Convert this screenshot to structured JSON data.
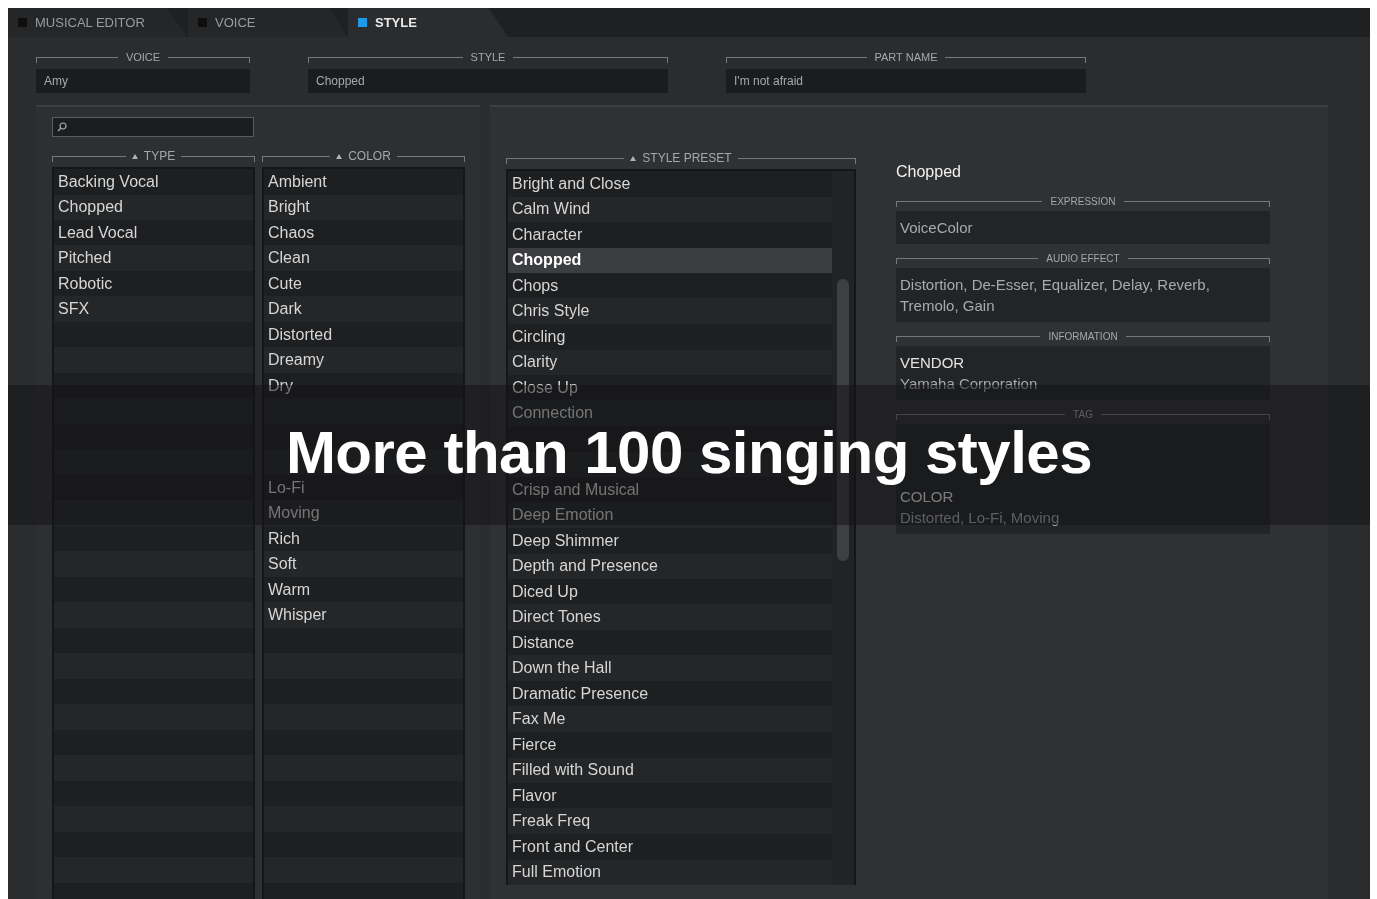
{
  "tabs": [
    {
      "label": "MUSICAL EDITOR",
      "selected": false
    },
    {
      "label": "VOICE",
      "selected": false
    },
    {
      "label": "STYLE",
      "selected": true
    }
  ],
  "fields": [
    {
      "label": "VOICE",
      "value": "Amy"
    },
    {
      "label": "STYLE",
      "value": "Chopped"
    },
    {
      "label": "PART NAME",
      "value": "I'm not afraid"
    }
  ],
  "type_list": {
    "header": "TYPE",
    "items": [
      {
        "label": "Backing Vocal",
        "selected": false
      },
      {
        "label": "Chopped",
        "selected": false
      },
      {
        "label": "Lead Vocal",
        "selected": false
      },
      {
        "label": "Pitched",
        "selected": false
      },
      {
        "label": "Robotic",
        "selected": false
      },
      {
        "label": "SFX",
        "selected": false
      }
    ]
  },
  "color_list": {
    "header": "COLOR",
    "items": [
      {
        "label": "Ambient",
        "selected": false
      },
      {
        "label": "Bright",
        "selected": false
      },
      {
        "label": "Chaos",
        "selected": false
      },
      {
        "label": "Clean",
        "selected": false
      },
      {
        "label": "Cute",
        "selected": false
      },
      {
        "label": "Dark",
        "selected": false
      },
      {
        "label": "Distorted",
        "selected": false
      },
      {
        "label": "Dreamy",
        "selected": false
      },
      {
        "label": "Dry",
        "selected": false
      },
      {
        "kind": "blank"
      },
      {
        "kind": "blank"
      },
      {
        "kind": "blank"
      },
      {
        "label": "Lo-Fi",
        "selected": false
      },
      {
        "label": "Moving",
        "selected": false
      },
      {
        "label": "Rich",
        "selected": false
      },
      {
        "label": "Soft",
        "selected": false
      },
      {
        "label": "Warm",
        "selected": false
      },
      {
        "label": "Whisper",
        "selected": false
      }
    ]
  },
  "style_preset_list": {
    "header": "STYLE PRESET",
    "items": [
      {
        "label": "Bright and Close",
        "selected": false
      },
      {
        "label": "Calm Wind",
        "selected": false
      },
      {
        "label": "Character",
        "selected": false
      },
      {
        "label": "Chopped",
        "selected": true
      },
      {
        "label": "Chops",
        "selected": false
      },
      {
        "label": "Chris Style",
        "selected": false
      },
      {
        "label": "Circling",
        "selected": false
      },
      {
        "label": "Clarity",
        "selected": false
      },
      {
        "label": "Close Up",
        "selected": false
      },
      {
        "label": "Connection",
        "selected": false
      },
      {
        "kind": "blank"
      },
      {
        "kind": "blank"
      },
      {
        "label": "Crisp and Musical",
        "selected": false
      },
      {
        "label": "Deep Emotion",
        "selected": false
      },
      {
        "label": "Deep Shimmer",
        "selected": false
      },
      {
        "label": "Depth and Presence",
        "selected": false
      },
      {
        "label": "Diced Up",
        "selected": false
      },
      {
        "label": "Direct Tones",
        "selected": false
      },
      {
        "label": "Distance",
        "selected": false
      },
      {
        "label": "Down the Hall",
        "selected": false
      },
      {
        "label": "Dramatic Presence",
        "selected": false
      },
      {
        "label": "Fax Me",
        "selected": false
      },
      {
        "label": "Fierce",
        "selected": false
      },
      {
        "label": "Filled with Sound",
        "selected": false
      },
      {
        "label": "Flavor",
        "selected": false
      },
      {
        "label": "Freak Freq",
        "selected": false
      },
      {
        "label": "Front and Center",
        "selected": false
      },
      {
        "label": "Full Emotion",
        "selected": false
      }
    ]
  },
  "detail": {
    "title": "Chopped",
    "sections": [
      {
        "heading": "EXPRESSION",
        "kind": "text",
        "text": "VoiceColor"
      },
      {
        "heading": "AUDIO EFFECT",
        "kind": "text",
        "text": "Distortion, De-Esser, Equalizer, Delay, Reverb, Tremolo, Gain"
      },
      {
        "heading": "INFORMATION",
        "kind": "entries",
        "entries": [
          {
            "key": "VENDOR",
            "value": "Yamaha Corporation"
          }
        ]
      },
      {
        "heading": "TAG",
        "kind": "entries",
        "entries": [
          {
            "key": "COLOR",
            "value": "Distorted, Lo-Fi, Moving"
          }
        ]
      }
    ]
  },
  "banner": {
    "text": "More than 100 singing styles"
  }
}
